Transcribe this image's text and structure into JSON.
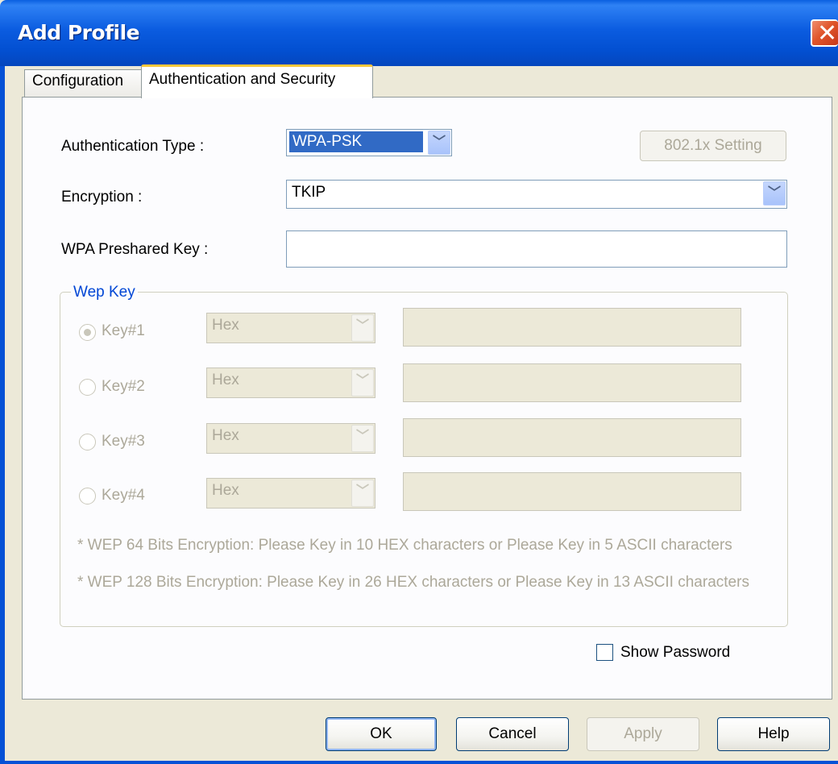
{
  "window": {
    "title": "Add Profile"
  },
  "tabs": [
    {
      "label": "Configuration",
      "active": false
    },
    {
      "label": "Authentication and Security",
      "active": true
    }
  ],
  "form": {
    "auth_type_label": "Authentication Type :",
    "auth_type_value": "WPA-PSK",
    "setting_button": "802.1x Setting",
    "encryption_label": "Encryption :",
    "encryption_value": "TKIP",
    "psk_label": "WPA Preshared Key :",
    "psk_value": ""
  },
  "wep": {
    "group_title": "Wep Key",
    "keys": [
      {
        "label": "Key#1",
        "format": "Hex",
        "checked": true
      },
      {
        "label": "Key#2",
        "format": "Hex",
        "checked": false
      },
      {
        "label": "Key#3",
        "format": "Hex",
        "checked": false
      },
      {
        "label": "Key#4",
        "format": "Hex",
        "checked": false
      }
    ],
    "note_64": "* WEP 64 Bits Encryption:   Please Key in 10 HEX characters  or   Please Key in 5 ASCII characters",
    "note_128": "* WEP 128 Bits Encryption:   Please Key in 26 HEX characters  or  Please Key in 13 ASCII characters"
  },
  "show_password_label": "Show Password",
  "buttons": {
    "ok": "OK",
    "cancel": "Cancel",
    "apply": "Apply",
    "help": "Help"
  },
  "icons": {
    "close": "close-icon",
    "dropdown": "chevron-down-icon"
  }
}
